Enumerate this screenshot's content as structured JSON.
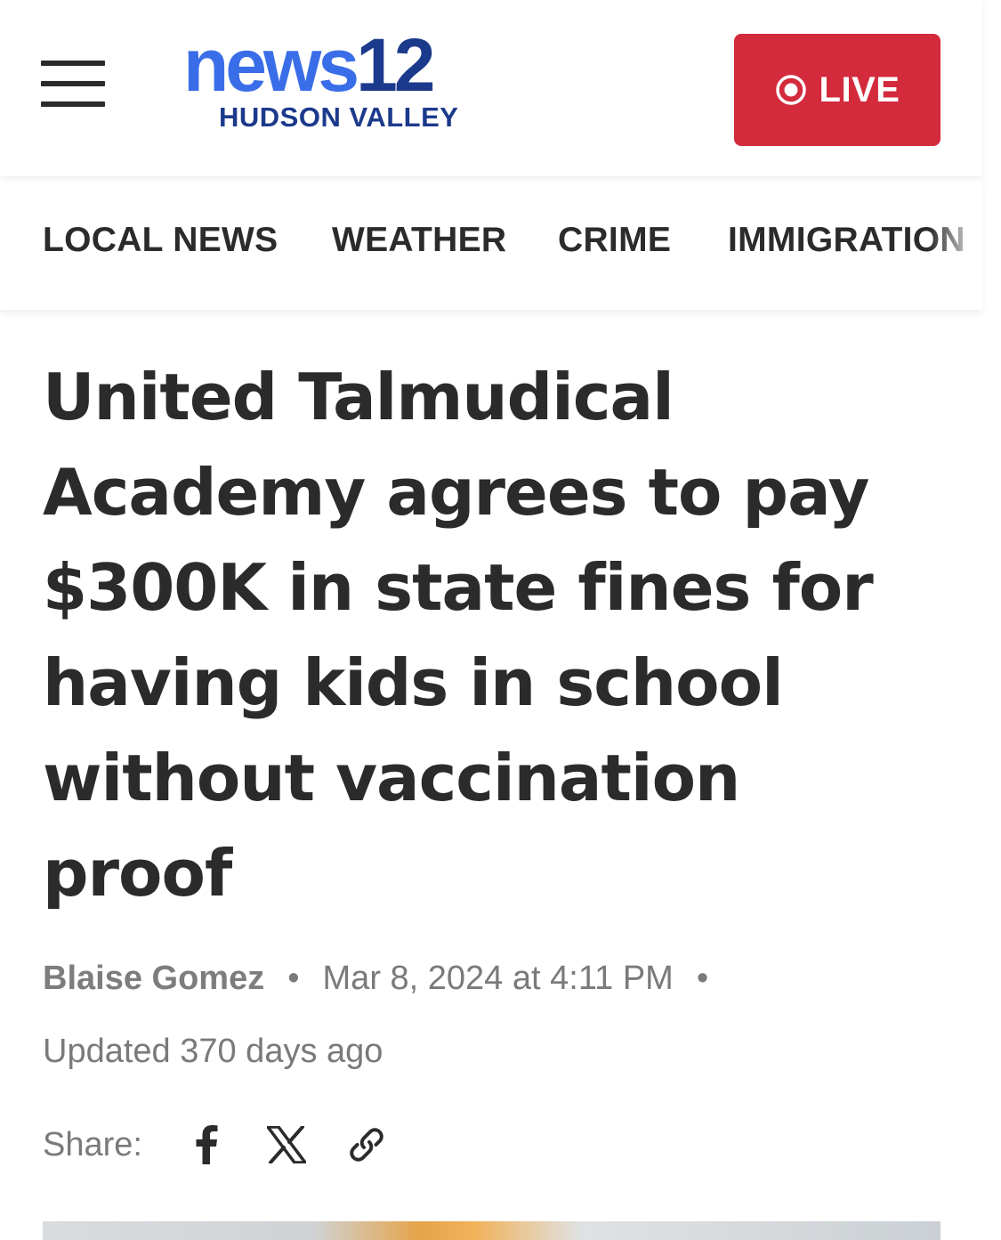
{
  "header": {
    "logo_main_news": "news",
    "logo_main_num": "12",
    "logo_sub": "HUDSON VALLEY",
    "live_label": "LIVE",
    "menu_icon": "hamburger-icon",
    "live_icon": "record-icon"
  },
  "nav": {
    "items": [
      {
        "label": "LOCAL NEWS"
      },
      {
        "label": "WEATHER"
      },
      {
        "label": "CRIME"
      },
      {
        "label": "IMMIGRATION"
      }
    ]
  },
  "article": {
    "headline": "United Talmudical Academy agrees to pay $300K in state fines for having kids in school without vaccination proof",
    "author": "Blaise Gomez",
    "date": "Mar 8, 2024 at 4:11 PM",
    "separator": "•",
    "updated": "Updated 370 days ago",
    "share_label": "Share:",
    "share_icons": [
      "facebook-icon",
      "x-icon",
      "link-icon"
    ]
  },
  "colors": {
    "brand_blue": "#3a6ee8",
    "brand_navy": "#1c3a8c",
    "live_red": "#d32a3c",
    "text_dark": "#2b2b2b",
    "text_muted": "#7a7a7a"
  }
}
